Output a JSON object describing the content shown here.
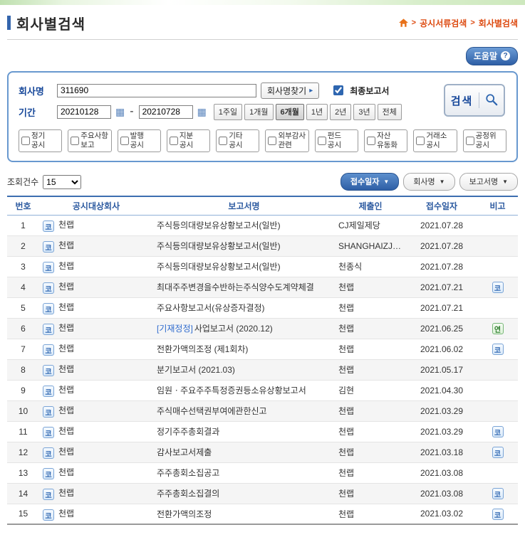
{
  "page": {
    "title": "회사별검색"
  },
  "breadcrumb": {
    "items": [
      "공시서류검색",
      "회사별검색"
    ]
  },
  "help": {
    "label": "도움말",
    "icon_text": "?"
  },
  "search": {
    "company_label": "회사명",
    "company_value": "311690",
    "find_company_button": "회사명찾기",
    "final_report_label": "최종보고서",
    "final_report_checked": true,
    "period_label": "기간",
    "date_from": "20210128",
    "date_to": "20210728",
    "period_buttons": [
      {
        "label": "1주일",
        "active": false
      },
      {
        "label": "1개월",
        "active": false
      },
      {
        "label": "6개월",
        "active": true
      },
      {
        "label": "1년",
        "active": false
      },
      {
        "label": "2년",
        "active": false
      },
      {
        "label": "3년",
        "active": false
      },
      {
        "label": "전체",
        "active": false
      }
    ],
    "search_button": "검색",
    "categories": [
      {
        "line1": "정기",
        "line2": "공시"
      },
      {
        "line1": "주요사항",
        "line2": "보고"
      },
      {
        "line1": "발행",
        "line2": "공시"
      },
      {
        "line1": "지분",
        "line2": "공시"
      },
      {
        "line1": "기타",
        "line2": "공시"
      },
      {
        "line1": "외부감사",
        "line2": "관련"
      },
      {
        "line1": "펀드",
        "line2": "공시"
      },
      {
        "line1": "자산",
        "line2": "유동화"
      },
      {
        "line1": "거래소",
        "line2": "공시"
      },
      {
        "line1": "공정위",
        "line2": "공시"
      }
    ]
  },
  "toolbar": {
    "count_label": "조회건수",
    "count_value": "15",
    "sort_buttons": [
      {
        "label": "접수일자",
        "active": true
      },
      {
        "label": "회사명",
        "active": false
      },
      {
        "label": "보고서명",
        "active": false
      }
    ]
  },
  "colors": {
    "accent_blue": "#3465ad",
    "breadcrumb_red": "#dd4a10",
    "badge_blue": "#2e66b0",
    "badge_green": "#2e7d2e"
  },
  "table": {
    "headers": [
      "번호",
      "공시대상회사",
      "보고서명",
      "제출인",
      "접수일자",
      "비고"
    ],
    "market_badge": "코",
    "rows": [
      {
        "no": "1",
        "company": "천랩",
        "report_tag": "",
        "report": "주식등의대량보유상황보고서(일반)",
        "submitter": "CJ제일제당",
        "date": "2021.07.28",
        "remark": ""
      },
      {
        "no": "2",
        "company": "천랩",
        "report_tag": "",
        "report": "주식등의대량보유상황보고서(일반)",
        "submitter": "SHANGHAIZJB…",
        "date": "2021.07.28",
        "remark": ""
      },
      {
        "no": "3",
        "company": "천랩",
        "report_tag": "",
        "report": "주식등의대량보유상황보고서(일반)",
        "submitter": "천종식",
        "date": "2021.07.28",
        "remark": ""
      },
      {
        "no": "4",
        "company": "천랩",
        "report_tag": "",
        "report": "최대주주변경을수반하는주식양수도계약체결",
        "submitter": "천랩",
        "date": "2021.07.21",
        "remark": "코"
      },
      {
        "no": "5",
        "company": "천랩",
        "report_tag": "",
        "report": "주요사항보고서(유상증자결정)",
        "submitter": "천랩",
        "date": "2021.07.21",
        "remark": ""
      },
      {
        "no": "6",
        "company": "천랩",
        "report_tag": "[기재정정]",
        "report": "사업보고서 (2020.12)",
        "submitter": "천랩",
        "date": "2021.06.25",
        "remark": "연"
      },
      {
        "no": "7",
        "company": "천랩",
        "report_tag": "",
        "report": "전환가액의조정 (제1회차)",
        "submitter": "천랩",
        "date": "2021.06.02",
        "remark": "코"
      },
      {
        "no": "8",
        "company": "천랩",
        "report_tag": "",
        "report": "분기보고서 (2021.03)",
        "submitter": "천랩",
        "date": "2021.05.17",
        "remark": ""
      },
      {
        "no": "9",
        "company": "천랩",
        "report_tag": "",
        "report": "임원ㆍ주요주주특정증권등소유상황보고서",
        "submitter": "김현",
        "date": "2021.04.30",
        "remark": ""
      },
      {
        "no": "10",
        "company": "천랩",
        "report_tag": "",
        "report": "주식매수선택권부여에관한신고",
        "submitter": "천랩",
        "date": "2021.03.29",
        "remark": ""
      },
      {
        "no": "11",
        "company": "천랩",
        "report_tag": "",
        "report": "정기주주총회결과",
        "submitter": "천랩",
        "date": "2021.03.29",
        "remark": "코"
      },
      {
        "no": "12",
        "company": "천랩",
        "report_tag": "",
        "report": "감사보고서제출",
        "submitter": "천랩",
        "date": "2021.03.18",
        "remark": "코"
      },
      {
        "no": "13",
        "company": "천랩",
        "report_tag": "",
        "report": "주주총회소집공고",
        "submitter": "천랩",
        "date": "2021.03.08",
        "remark": ""
      },
      {
        "no": "14",
        "company": "천랩",
        "report_tag": "",
        "report": "주주총회소집결의",
        "submitter": "천랩",
        "date": "2021.03.08",
        "remark": "코"
      },
      {
        "no": "15",
        "company": "천랩",
        "report_tag": "",
        "report": "전환가액의조정",
        "submitter": "천랩",
        "date": "2021.03.02",
        "remark": "코"
      }
    ]
  }
}
